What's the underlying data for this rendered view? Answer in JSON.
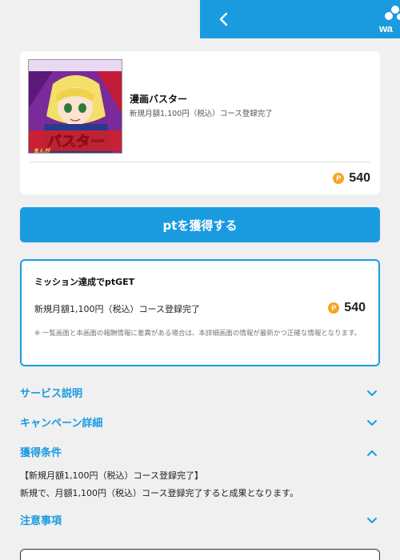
{
  "header": {
    "back_icon": "chevron-left-icon",
    "logo_text": "wa"
  },
  "offer": {
    "title": "漫画バスター",
    "subtitle": "新規月額1,100円（税込）コース登録完了",
    "thumbnail_text": "バスター",
    "thumbnail_small": "まんが",
    "coin_symbol": "P",
    "points": "540"
  },
  "get_button": {
    "label": "ptを獲得する"
  },
  "mission": {
    "title": "ミッション達成でptGET",
    "condition": "新規月額1,100円（税込）コース登録完了",
    "coin_symbol": "P",
    "points": "540",
    "note": "※ 一覧画面と本画面の報酬情報に差異がある場合は、本詳細画面の情報が最新かつ正確な情報となります。"
  },
  "sections": {
    "service": {
      "label": "サービス説明",
      "state": "collapsed"
    },
    "campaign": {
      "label": "キャンペーン詳細",
      "state": "collapsed"
    },
    "conditions": {
      "label": "獲得条件",
      "state": "expanded",
      "line1": "【新規月額1,100円（税込）コース登録完了】",
      "line2": "新規で、月額1,100円（税込）コース登録完了すると成果となります。"
    },
    "notes": {
      "label": "注意事項",
      "state": "collapsed"
    }
  },
  "colors": {
    "accent": "#1a9be0",
    "coin": "#f5a623",
    "background": "#f0f0f0"
  }
}
